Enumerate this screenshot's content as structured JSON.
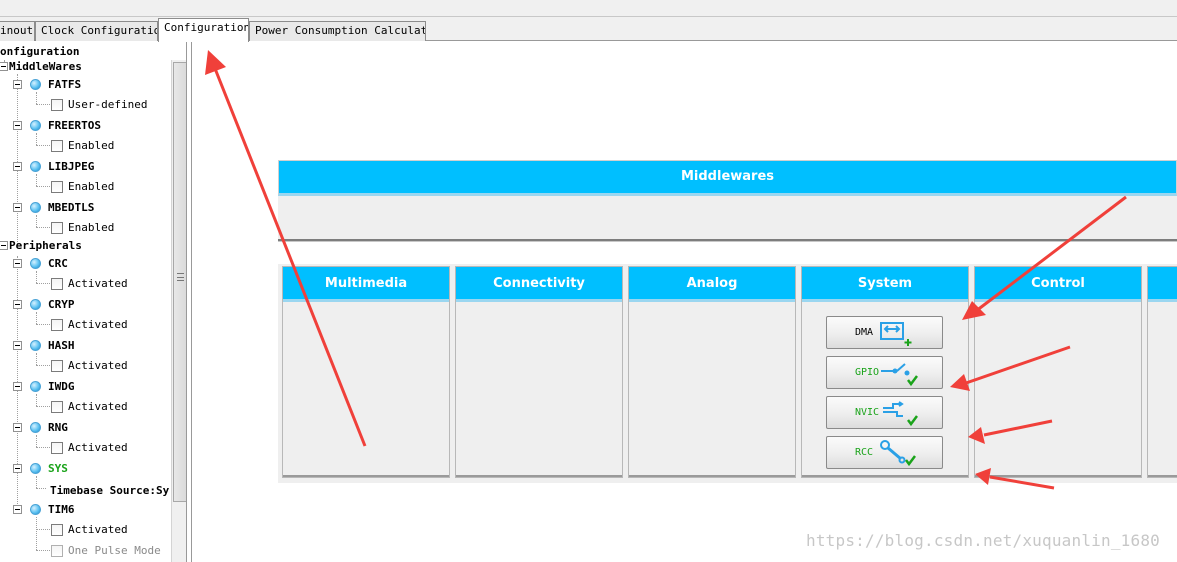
{
  "tabs": [
    {
      "label": "inout"
    },
    {
      "label": "Clock Configuration"
    },
    {
      "label": "Configuration"
    },
    {
      "label": "Power Consumption Calculator"
    }
  ],
  "tree": {
    "root": "onfiguration",
    "middlewares": {
      "label": "MiddleWares",
      "items": [
        {
          "name": "FATFS",
          "option": "User-defined"
        },
        {
          "name": "FREERTOS",
          "option": "Enabled"
        },
        {
          "name": "LIBJPEG",
          "option": "Enabled"
        },
        {
          "name": "MBEDTLS",
          "option": "Enabled"
        }
      ]
    },
    "peripherals": {
      "label": "Peripherals",
      "items": [
        {
          "name": "CRC",
          "option": "Activated"
        },
        {
          "name": "CRYP",
          "option": "Activated"
        },
        {
          "name": "HASH",
          "option": "Activated"
        },
        {
          "name": "IWDG",
          "option": "Activated"
        },
        {
          "name": "RNG",
          "option": "Activated"
        },
        {
          "name": "SYS",
          "option": "Timebase Source:Sy"
        },
        {
          "name": "TIM6",
          "option": "Activated",
          "option2": "One Pulse Mode"
        }
      ]
    }
  },
  "middlewares_panel": {
    "title": "Middlewares"
  },
  "categories": [
    "Multimedia",
    "Connectivity",
    "Analog",
    "System",
    "Control"
  ],
  "system_buttons": [
    {
      "label": "DMA",
      "icon": "dma-icon"
    },
    {
      "label": "GPIO",
      "icon": "gpio-icon"
    },
    {
      "label": "NVIC",
      "icon": "nvic-icon"
    },
    {
      "label": "RCC",
      "icon": "rcc-icon"
    }
  ],
  "colors": {
    "header_blue": "#00bfff",
    "ok_green": "#1aa31a",
    "arrow_red": "#f0403a"
  },
  "watermark": "https://blog.csdn.net/xuquanlin_1680"
}
